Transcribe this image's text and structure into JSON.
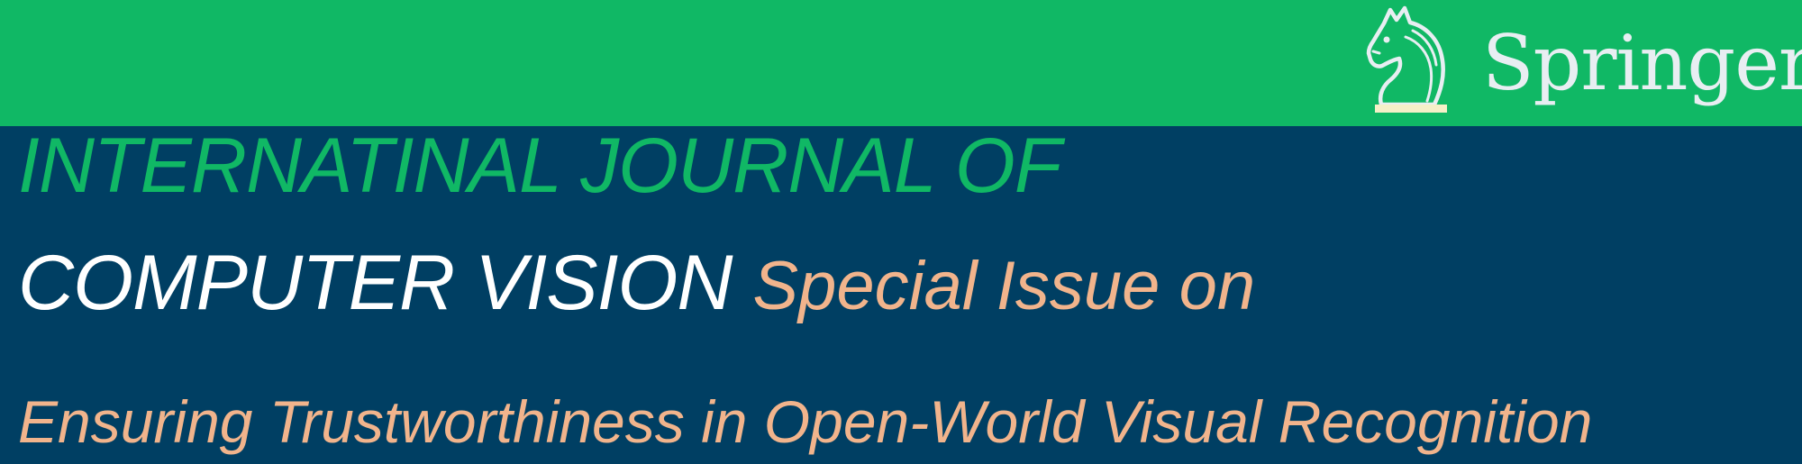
{
  "banner": {
    "colors": {
      "top_bar": "#10b865",
      "background": "#003f63",
      "journal_title_first_line": "#10b865",
      "journal_title_second_line": "#ffffff",
      "special_issue": "#f1b48c",
      "logo": "#e8eef2",
      "logo_underline": "#f5f0c8"
    },
    "logo": {
      "icon": "knight-chess-horse-icon",
      "wordmark": "Springer"
    },
    "journal_title_line1": "INTERNATINAL JOURNAL OF",
    "journal_title_line2": "COMPUTER VISION",
    "special_issue_label": "Special Issue on",
    "special_issue_topic": "Ensuring Trustworthiness in Open-World Visual Recognition"
  }
}
